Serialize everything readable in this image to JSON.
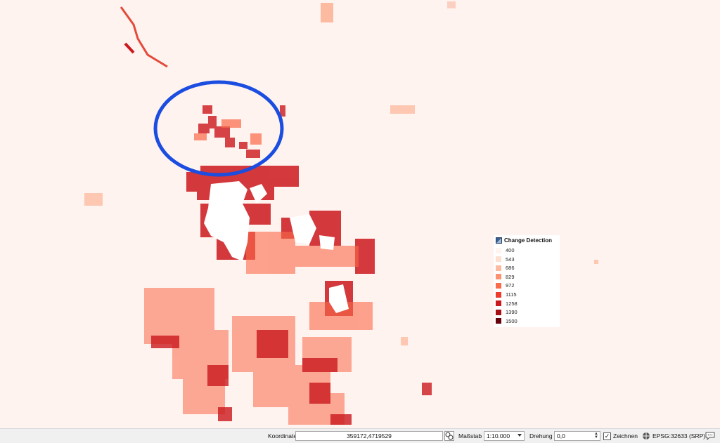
{
  "map": {
    "layer_color_ramp": [
      "#fff5f0",
      "#fee0d2",
      "#fcbba1",
      "#fc9272",
      "#fb6a4a",
      "#ef3b2c",
      "#cb181d",
      "#a50f15",
      "#67000d"
    ],
    "highlight_color": "#1a4de0"
  },
  "legend": {
    "title": "Change Detection",
    "icon": "raster-layer-icon",
    "entries": [
      {
        "label": "400",
        "color": "#fff5f0"
      },
      {
        "label": "543",
        "color": "#fde0d2"
      },
      {
        "label": "686",
        "color": "#fcbba1"
      },
      {
        "label": "829",
        "color": "#fc9272"
      },
      {
        "label": "972",
        "color": "#fb6a4a"
      },
      {
        "label": "1115",
        "color": "#ef3b2c"
      },
      {
        "label": "1258",
        "color": "#cb181d"
      },
      {
        "label": "1390",
        "color": "#a50f15"
      },
      {
        "label": "1500",
        "color": "#67000d"
      }
    ]
  },
  "statusbar": {
    "coordinate_label": "Koordinate",
    "coordinate_value": "359172,4719529",
    "scale_label": "Maßstab",
    "scale_value": "1:10.000",
    "rotation_label": "Drehung",
    "rotation_value": "0,0",
    "render_label": "Zeichnen",
    "render_checked": true,
    "crs_label": "EPSG:32633 (SRP)"
  }
}
